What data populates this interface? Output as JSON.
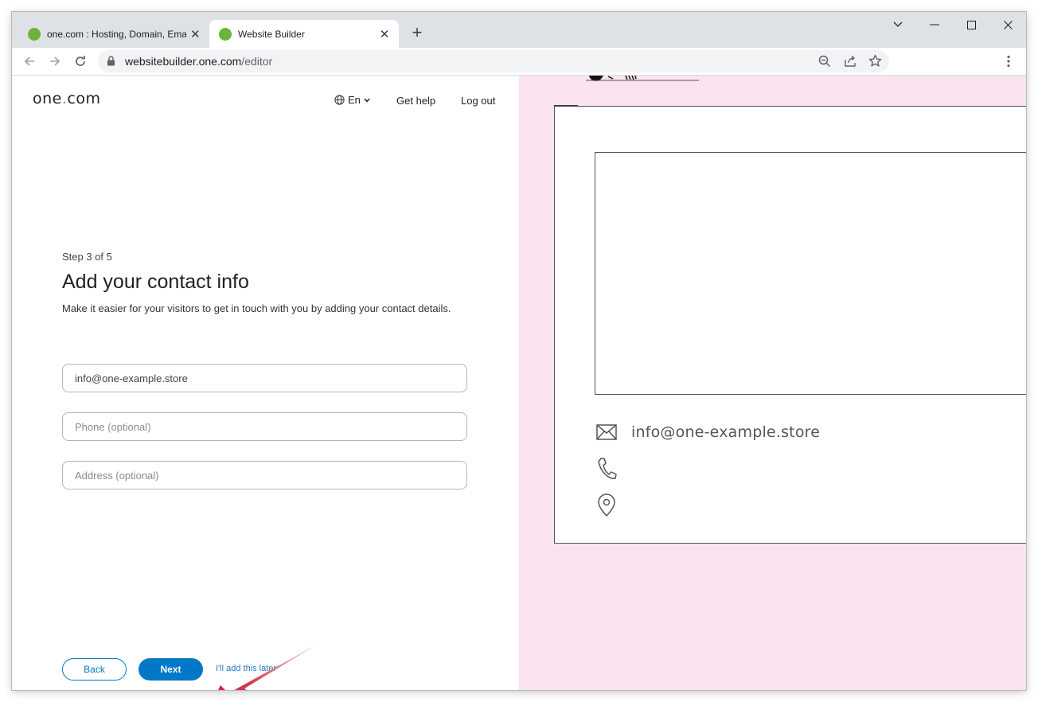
{
  "browser": {
    "tabs": [
      {
        "title": "one.com : Hosting, Domain, Email",
        "active": false
      },
      {
        "title": "Website Builder",
        "active": true
      }
    ],
    "url_host": "websitebuilder.one.com",
    "url_path": "/editor"
  },
  "header": {
    "logo_left": "one",
    "logo_dot": ".",
    "logo_right": "com",
    "language": "En",
    "help": "Get help",
    "logout": "Log out"
  },
  "form": {
    "step": "Step 3 of 5",
    "title": "Add your contact info",
    "description": "Make it easier for your visitors to get in touch with you by adding your contact details.",
    "email_value": "info@one-example.store",
    "phone_placeholder": "Phone (optional)",
    "address_placeholder": "Address (optional)",
    "back": "Back",
    "next": "Next",
    "later": "I'll add this later"
  },
  "preview": {
    "email": "info@one-example.store",
    "background_color": "#f9e4ef"
  },
  "colors": {
    "accent": "#0078c8",
    "brand_green": "#6cb33e",
    "arrow": "#c8102e"
  }
}
